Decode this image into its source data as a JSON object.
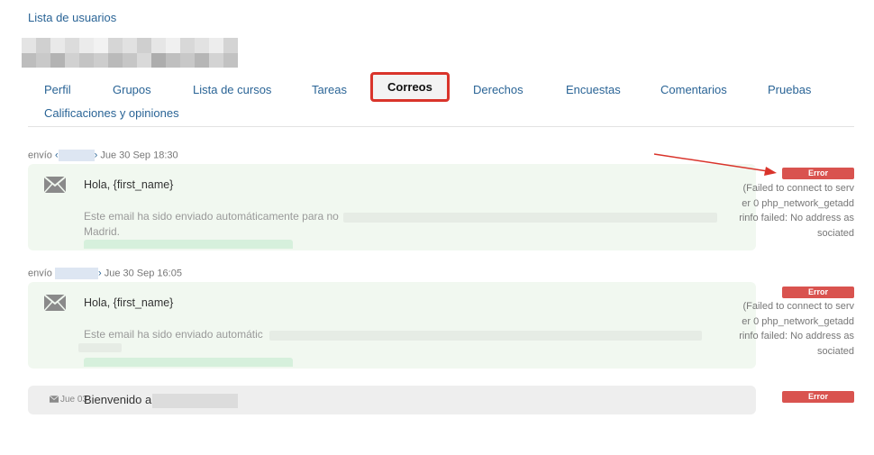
{
  "breadcrumb": {
    "label": "Lista de usuarios"
  },
  "tabs": [
    {
      "label": "Perfil"
    },
    {
      "label": "Grupos"
    },
    {
      "label": "Lista de cursos"
    },
    {
      "label": "Tareas"
    },
    {
      "label": "Correos"
    },
    {
      "label": "Derechos"
    },
    {
      "label": "Encuestas"
    },
    {
      "label": "Comentarios"
    },
    {
      "label": "Pruebas"
    },
    {
      "label": "Calificaciones y opiniones"
    }
  ],
  "active_tab": "Correos",
  "threads": [
    {
      "prefix": "envío",
      "date": "Jue 30 Sep 18:30",
      "greeting": "Hola, {first_name}",
      "body_start": "Este email ha sido enviado automáticamente para no",
      "body_line2": "Madrid.",
      "status": "Error",
      "error_detail": "(Failed to connect to server 0 php_network_getaddrinfo failed: No address associated"
    },
    {
      "prefix": "envío",
      "date": "Jue 30 Sep 16:05",
      "greeting": "Hola, {first_name}",
      "body_start": "Este email ha sido enviado automátic",
      "status": "Error",
      "error_detail": "(Failed to connect to server 0 php_network_getaddrinfo failed: No address associated"
    }
  ],
  "collapsed_mail": {
    "date": "Jue 03",
    "subject": "Bienvenido a",
    "status": "Error"
  },
  "colors": {
    "accent": "#2a6496",
    "error": "#d9534f",
    "highlight": "#d9342b",
    "card_bg": "#f1f8f0"
  }
}
